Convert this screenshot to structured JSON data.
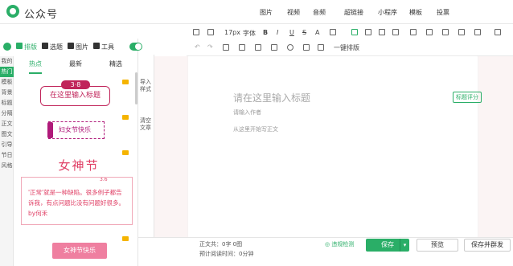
{
  "brand": "公众号",
  "topnav": [
    "图片",
    "视频",
    "音频",
    "超链接",
    "小程序",
    "模板",
    "投票"
  ],
  "left_toolbar": {
    "layout": "排版",
    "select": "选题",
    "image": "图片",
    "tools": "工具"
  },
  "vtabs": [
    "我的",
    "热门",
    "模板",
    "背景",
    "标题",
    "分隔",
    "正文",
    "图文",
    "引导",
    "节日",
    "风格"
  ],
  "subtabs": {
    "hot": "热点",
    "latest": "最新",
    "featured": "精选"
  },
  "templates": {
    "t1_top": "3·8",
    "t1_box": "在这里输入标题",
    "t2": "妇女节快乐",
    "t3_title": "女神节",
    "t3_sub": "3.6",
    "t3_body": "'正常'就是一种缺陷。很多例子都告诉我，有点问题比没有问题好很多。by何禾",
    "t4": "女神节快乐"
  },
  "mid_buttons": {
    "import": "导入样式",
    "clear": "清空文章"
  },
  "toolbar": {
    "font_size": "17px",
    "font_family": "字体",
    "bold": "B",
    "italic": "I",
    "underline": "U",
    "strike": "S",
    "font_color": "A",
    "one_key_layout": "一键排版"
  },
  "editor": {
    "title_placeholder": "请在这里输入标题",
    "author_placeholder": "请输入作者",
    "body_placeholder": "从这里开始写正文",
    "title_badge": "标题评分"
  },
  "footer": {
    "word_count": "正文共：0字 0图",
    "read_time": "预计阅读时间：0分钟",
    "check": "违规检测",
    "save": "保存",
    "preview": "预览",
    "publish": "保存并群发"
  },
  "colors": {
    "accent": "#2aae67",
    "template_red": "#c0245a",
    "template_pink": "#e04066"
  }
}
